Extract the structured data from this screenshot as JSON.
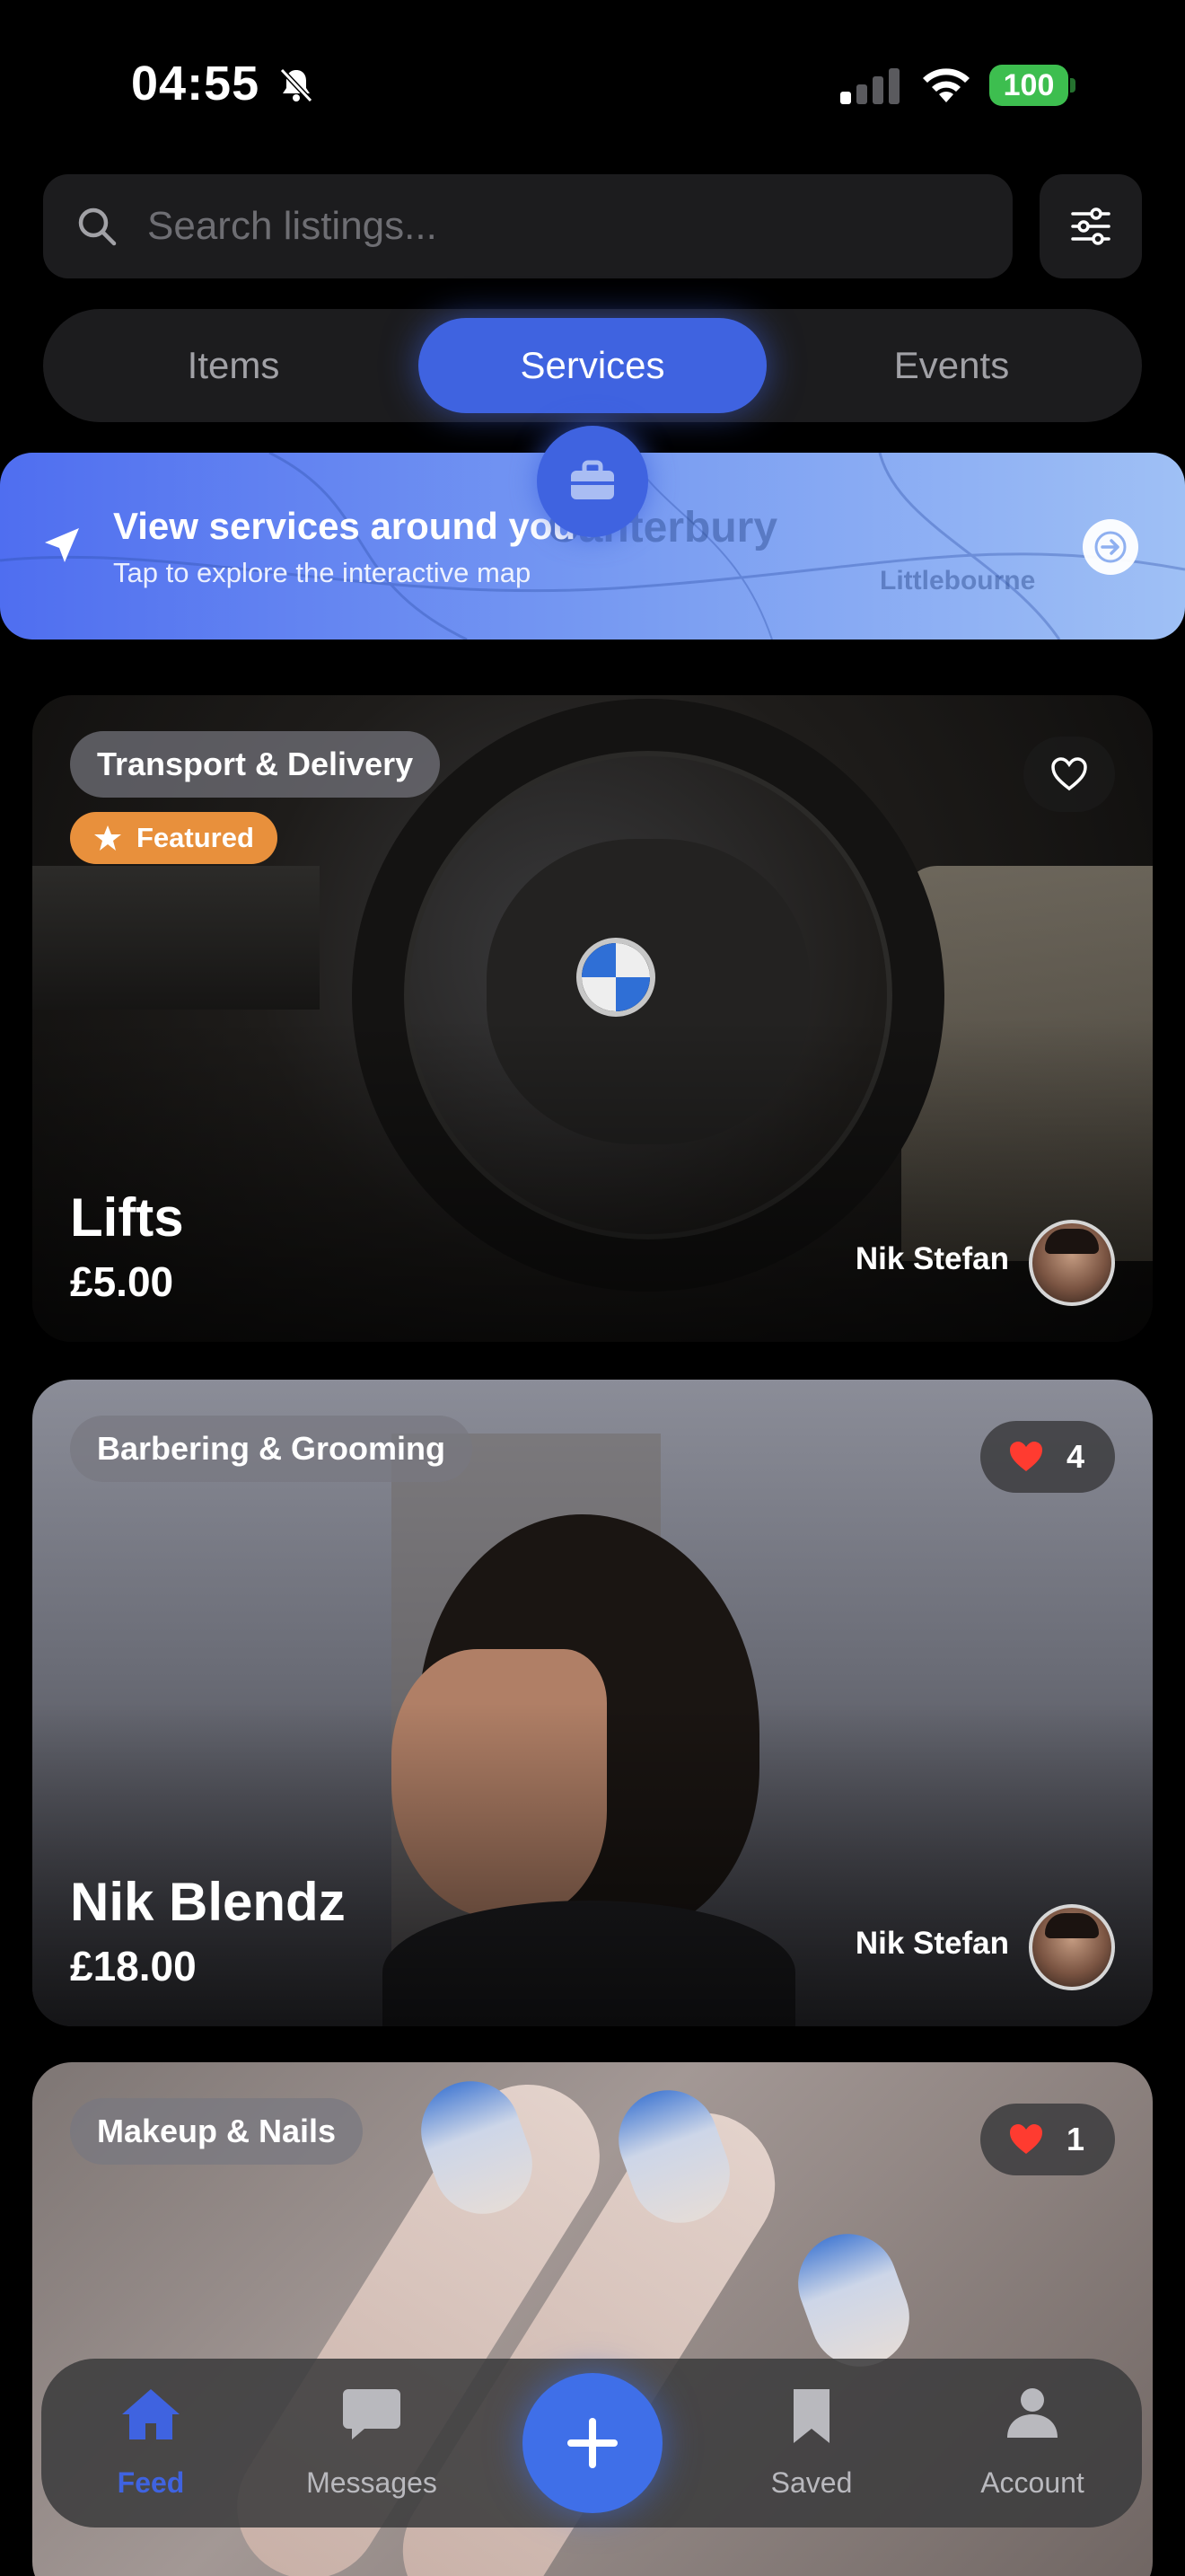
{
  "status_bar": {
    "time": "04:55",
    "battery": "100"
  },
  "search": {
    "placeholder": "Search listings..."
  },
  "segments": [
    {
      "label": "Items",
      "active": false
    },
    {
      "label": "Services",
      "active": true
    },
    {
      "label": "Events",
      "active": false
    }
  ],
  "map_banner": {
    "title": "View services around you",
    "subtitle": "Tap to explore the interactive map",
    "map_place_1": "Canterbury",
    "map_place_2": "Littlebourne"
  },
  "listings": [
    {
      "category": "Transport & Delivery",
      "featured": true,
      "featured_label": "Featured",
      "title": "Lifts",
      "price": "£5.00",
      "seller": "Nik Stefan",
      "likes": "",
      "favorited": false
    },
    {
      "category": "Barbering & Grooming",
      "featured": false,
      "title": "Nik Blendz",
      "price": "£18.00",
      "seller": "Nik Stefan",
      "likes": "4",
      "favorited": true
    },
    {
      "category": "Makeup & Nails",
      "featured": false,
      "title": "",
      "price": "",
      "seller": "",
      "likes": "1",
      "favorited": true
    }
  ],
  "tab_bar": {
    "feed": "Feed",
    "messages": "Messages",
    "saved": "Saved",
    "account": "Account",
    "active": "feed"
  },
  "colors": {
    "accent": "#3f63e0",
    "featured": "#e8903c",
    "like_heart": "#ff3b30",
    "battery": "#3dbe4f"
  },
  "icons": [
    "bell-slash-icon",
    "signal-icon",
    "wifi-icon",
    "battery-icon",
    "search-icon",
    "sliders-icon",
    "location-arrow-icon",
    "briefcase-icon",
    "arrow-right-icon",
    "heart-outline-icon",
    "heart-filled-icon",
    "star-icon",
    "home-icon",
    "chat-bubble-icon",
    "plus-icon",
    "bookmark-icon",
    "person-icon"
  ]
}
